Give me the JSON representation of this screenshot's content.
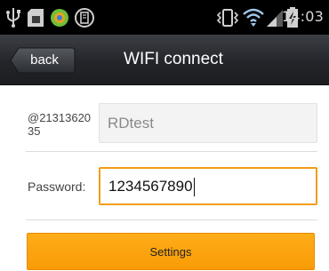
{
  "status_bar": {
    "time": "14:03",
    "left_icons": [
      "usb-icon",
      "sd-card-icon",
      "app-notification-icon",
      "storage-icon"
    ],
    "right_icons": [
      "vibrate-icon",
      "wifi-icon",
      "signal-icon",
      "battery-charging-icon"
    ]
  },
  "header": {
    "back_label": "back",
    "title": "WIFI connect"
  },
  "form": {
    "ssid_label": "@2131362035",
    "ssid_value": "RDtest",
    "password_label": "Password:",
    "password_value": "1234567890"
  },
  "actions": {
    "settings_label": "Settings"
  },
  "colors": {
    "accent": "#f7a10c",
    "focus_border": "#f29d17",
    "title_bar": "#2a2c31",
    "status_bar": "#000000"
  }
}
